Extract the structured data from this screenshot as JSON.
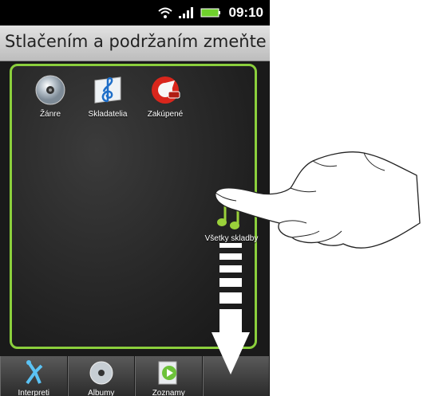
{
  "statusbar": {
    "time": "09:10",
    "icons": [
      "wifi-icon",
      "signal-icon",
      "battery-icon"
    ]
  },
  "header": {
    "title": "Stlačením a podržaním zmeňte uspor"
  },
  "panel_items": [
    {
      "label": "Žánre",
      "icon": "cd-icon"
    },
    {
      "label": "Skladatelia",
      "icon": "treble-clef-icon"
    },
    {
      "label": "Zakúpené",
      "icon": "purchased-icon"
    }
  ],
  "dragged_item": {
    "label": "Všetky skladby",
    "icon": "music-note-icon"
  },
  "tabs": [
    {
      "label": "Interpreti",
      "icon": "artist-icon"
    },
    {
      "label": "Albumy",
      "icon": "cd-icon"
    },
    {
      "label": "Zoznamy",
      "icon": "playlist-icon"
    },
    {
      "label": "",
      "icon": ""
    }
  ],
  "colors": {
    "accent": "#8bcf3c",
    "status_bar": "#000000",
    "title_bg": "#cfcfcf"
  }
}
